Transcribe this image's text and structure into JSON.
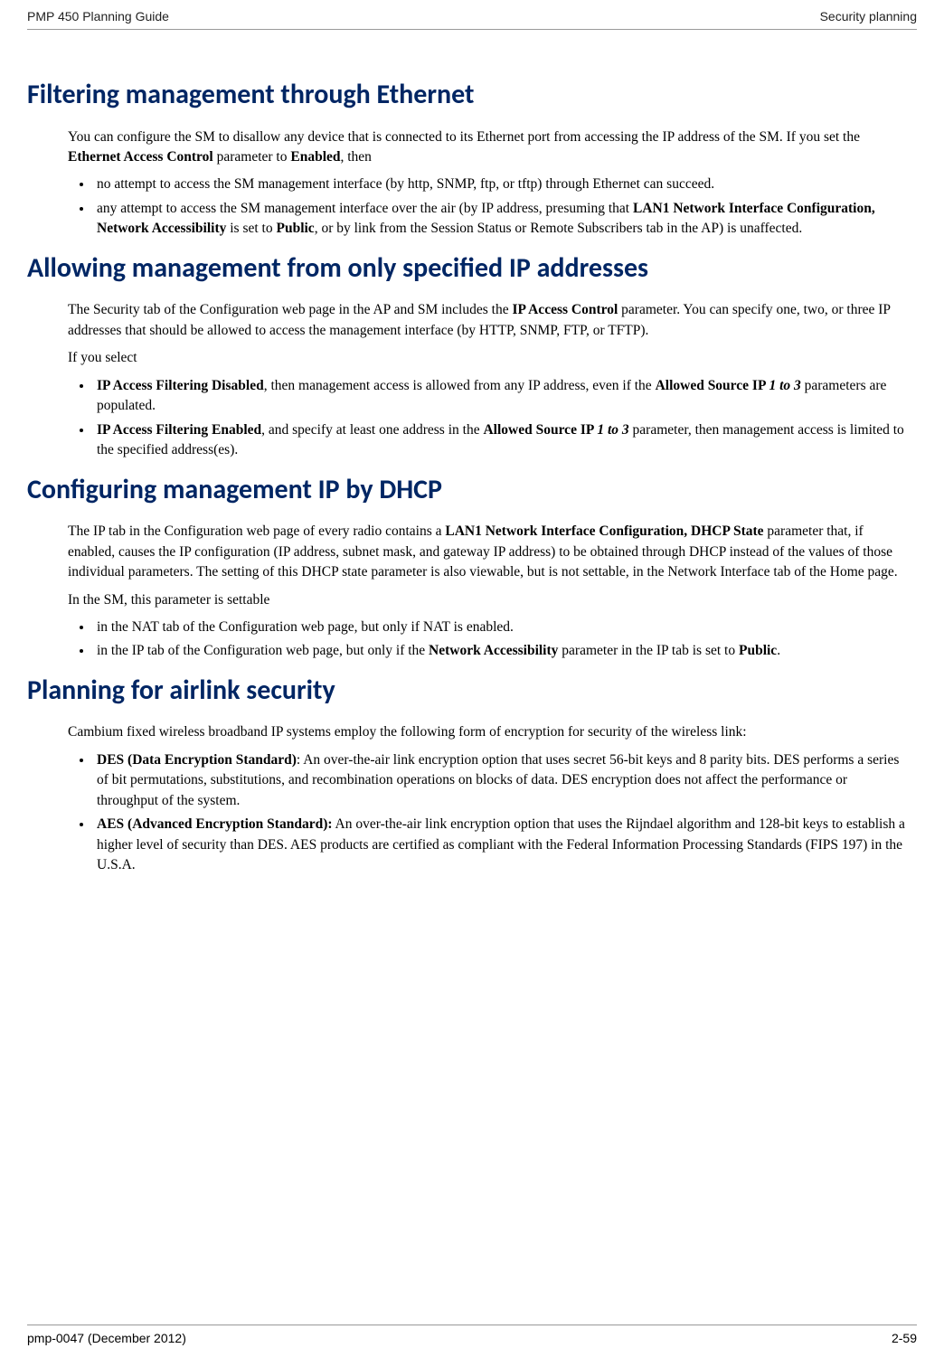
{
  "header": {
    "left": "PMP 450 Planning Guide",
    "right": "Security planning"
  },
  "footer": {
    "left": "pmp-0047 (December 2012)",
    "right": "2-59"
  },
  "sections": {
    "filtering": {
      "title": "Filtering management through Ethernet",
      "intro_a": "You can configure the SM to disallow any device that is connected to its Ethernet port from accessing the IP address of the SM. If you set the ",
      "intro_b_bold": "Ethernet Access Control",
      "intro_c": " parameter to ",
      "intro_d_bold": "Enabled",
      "intro_e": ", then",
      "li1": "no attempt to access the SM management interface (by http, SNMP, ftp, or tftp) through Ethernet can succeed.",
      "li2_a": "any attempt to access the SM management interface over the air (by IP address, presuming that ",
      "li2_b_bold": "LAN1 Network Interface Configuration, Network Accessibility",
      "li2_c": " is set to ",
      "li2_d_bold": "Public",
      "li2_e": ", or by link from the Session Status or Remote Subscribers tab in the AP) is unaffected."
    },
    "allowing": {
      "title": "Allowing management from only specified IP addresses",
      "p1_a": "The Security tab of the Configuration web page in the AP and SM includes the ",
      "p1_b_bold": "IP Access Control",
      "p1_c": " parameter. You can specify one, two, or three IP addresses that should be allowed to access the management interface (by HTTP, SNMP, FTP, or TFTP).",
      "p2": "If you select",
      "li1_a_bold": "IP Access Filtering Disabled",
      "li1_b": ", then management access is allowed from any IP address, even if the ",
      "li1_c_bold": "Allowed Source IP ",
      "li1_d_bi": "1 to 3",
      "li1_e": " parameters are populated.",
      "li2_a_bold": "IP Access Filtering Enabled",
      "li2_b": ", and specify at least one address in the ",
      "li2_c_bold": "Allowed Source IP ",
      "li2_d_bi": "1 to 3",
      "li2_e": " parameter, then management access is limited to the specified address(es)."
    },
    "dhcp": {
      "title": "Configuring management IP by DHCP",
      "p1_a": "The IP tab in the Configuration web page of every radio contains a ",
      "p1_b_bold": "LAN1 Network Interface Configuration, DHCP State",
      "p1_c": " parameter that, if enabled, causes the IP configuration (IP address, subnet mask, and gateway IP address) to be obtained through DHCP instead of the values of those individual parameters. The setting of this DHCP state parameter is also viewable, but is not settable, in the Network Interface tab of the Home page.",
      "p2": "In the SM, this parameter is settable",
      "li1": "in the NAT tab of the Configuration web page, but only if NAT is enabled.",
      "li2_a": "in the IP tab of the Configuration web page, but only if the ",
      "li2_b_bold": "Network Accessibility",
      "li2_c": " parameter in the IP tab is set to ",
      "li2_d_bold": "Public",
      "li2_e": "."
    },
    "airlink": {
      "title": "Planning for airlink security",
      "p1": "Cambium fixed wireless broadband IP systems employ the following form of encryption for security of the wireless link:",
      "li1_a_bold": "DES (Data Encryption Standard)",
      "li1_b": ":  An over-the-air link encryption option that uses secret 56-bit keys and 8 parity bits.  DES performs a series of bit permutations, substitutions, and recombination operations on blocks of data.  DES encryption does not affect the performance or throughput of the system.",
      "li2_a_bold": "AES (Advanced Encryption Standard):",
      "li2_b": "  An over-the-air link encryption option that uses the Rijndael algorithm and 128-bit keys to establish a higher level of security than DES.  AES products are certified as compliant with the Federal Information Processing Standards (FIPS 197) in the U.S.A."
    }
  }
}
